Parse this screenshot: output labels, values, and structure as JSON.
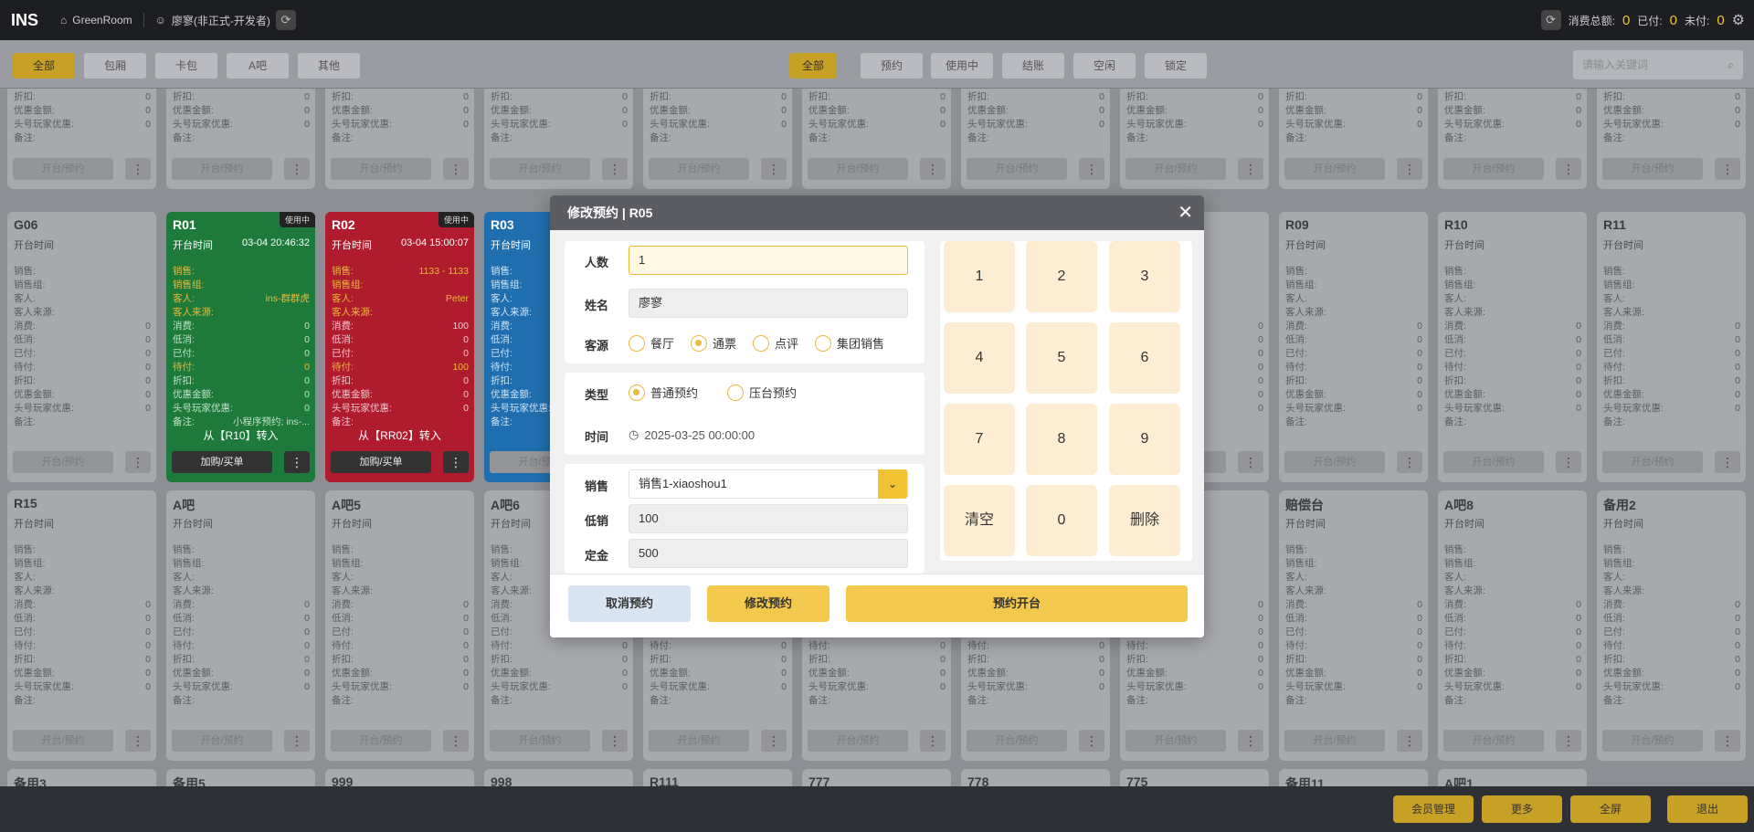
{
  "topbar": {
    "logo": "INS",
    "store": "GreenRoom",
    "user": "廖寥(非正式-开发者)",
    "consume_label": "消费总额:",
    "consume_value": "0",
    "paid_label": "已付:",
    "paid_value": "0",
    "unpaid_label": "未付:",
    "unpaid_value": "0"
  },
  "filters": {
    "area": [
      "全部",
      "包厢",
      "卡包",
      "A吧",
      "其他"
    ],
    "status": [
      "全部",
      "预约",
      "使用中",
      "结账",
      "空闲",
      "锁定"
    ],
    "search_placeholder": "请输入关键词"
  },
  "card_labels": {
    "open_time": "开台时间",
    "sales": "销售:",
    "sales_group": "销售组:",
    "guest": "客人:",
    "guest_source": "客人来源:",
    "consume": "消费:",
    "low": "低消:",
    "paid": "已付:",
    "unpaid": "待付:",
    "discount": "折扣:",
    "coupon": "优惠金额:",
    "vip": "头号玩家优惠:",
    "remark": "备注:",
    "open_btn": "开台/预约",
    "buy_btn": "加购/买单",
    "more": "⋮",
    "in_use": "使用中",
    "zero": "0"
  },
  "rooms_row1": [
    "G06",
    "R01",
    "R02",
    "R03",
    "",
    "",
    "",
    "",
    "R09",
    "R10",
    "R11"
  ],
  "rooms_row2": [
    "R15",
    "A吧",
    "A吧5",
    "A吧6",
    "",
    "",
    "",
    "",
    "赔偿台",
    "A吧8",
    "备用2"
  ],
  "rooms_row3": [
    "备用3",
    "备用5",
    "999",
    "998",
    "R111",
    "777",
    "778",
    "775",
    "备用11",
    "A吧1"
  ],
  "r01": {
    "time": "03-04 20:46:32",
    "guest": "ins-群群虎",
    "remark": "小程序预约; ins-...",
    "transfer": "从【R10】转入"
  },
  "r02": {
    "time": "03-04 15:00:07",
    "sales": "1133 - 1133",
    "guest": "Peter",
    "consume": "100",
    "unpaid": "100",
    "transfer": "从【RR02】转入"
  },
  "bottombar": [
    "会员管理",
    "更多",
    "全屏",
    "退出"
  ],
  "modal": {
    "title": "修改预约 | R05",
    "close": "✕",
    "people_label": "人数",
    "people_value": "1",
    "name_label": "姓名",
    "name_value": "廖寥",
    "source_label": "客源",
    "sources": [
      "餐厅",
      "通票",
      "点评",
      "集团销售"
    ],
    "type_label": "类型",
    "types": [
      "普通预约",
      "压台预约"
    ],
    "time_label": "时间",
    "time_value": "2025-03-25 00:00:00",
    "sales_label": "销售",
    "sales_value": "销售1-xiaoshou1",
    "low_label": "低销",
    "low_value": "100",
    "deposit_label": "定金",
    "deposit_value": "500",
    "keys": [
      "1",
      "2",
      "3",
      "4",
      "5",
      "6",
      "7",
      "8",
      "9",
      "清空",
      "0",
      "删除"
    ],
    "cancel_btn": "取消预约",
    "modify_btn": "修改预约",
    "open_btn": "预约开台"
  }
}
